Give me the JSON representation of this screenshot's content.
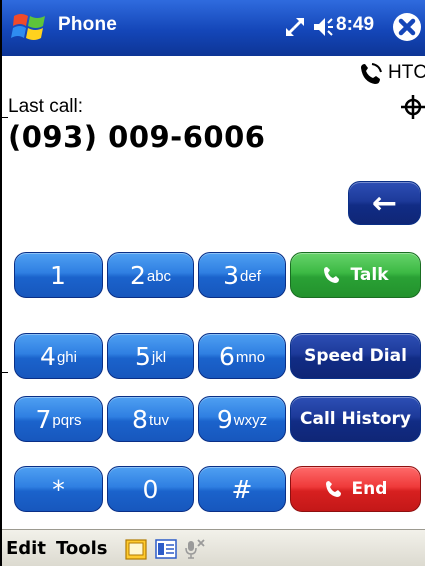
{
  "titlebar": {
    "app_title": "Phone",
    "clock": "8:49"
  },
  "info": {
    "carrier": "HTC",
    "last_call_label": "Last call:",
    "last_call_number": "(093) 009-6006"
  },
  "keypad": {
    "keys": [
      {
        "digit": "1",
        "letters": ""
      },
      {
        "digit": "2",
        "letters": "abc"
      },
      {
        "digit": "3",
        "letters": "def"
      },
      {
        "digit": "4",
        "letters": "ghi"
      },
      {
        "digit": "5",
        "letters": "jkl"
      },
      {
        "digit": "6",
        "letters": "mno"
      },
      {
        "digit": "7",
        "letters": "pqrs"
      },
      {
        "digit": "8",
        "letters": "tuv"
      },
      {
        "digit": "9",
        "letters": "wxyz"
      },
      {
        "digit": "*",
        "letters": ""
      },
      {
        "digit": "0",
        "letters": ""
      },
      {
        "digit": "#",
        "letters": ""
      }
    ],
    "talk_label": "Talk",
    "speed_dial_label": "Speed Dial",
    "call_history_label": "Call History",
    "end_label": "End",
    "backspace_glyph": "←"
  },
  "menubar": {
    "edit_label": "Edit",
    "tools_label": "Tools"
  },
  "colors": {
    "titlebar": "#1446b8",
    "key_blue": "#2f7fe2",
    "key_navy": "#1d3a9a",
    "talk_green": "#3cb944",
    "end_red": "#ef3a3a"
  },
  "icons": {
    "start": "windows-flag-icon",
    "connectivity": "connectivity-arrows-icon",
    "volume": "speaker-icon",
    "close": "close-icon",
    "carrier": "phone-signal-icon",
    "signal": "signal-target-icon",
    "talk": "phone-handset-icon",
    "end": "phone-handset-icon",
    "menubar_1": "folder-icon",
    "menubar_2": "input-panel-icon",
    "menubar_3": "microphone-muted-icon"
  }
}
